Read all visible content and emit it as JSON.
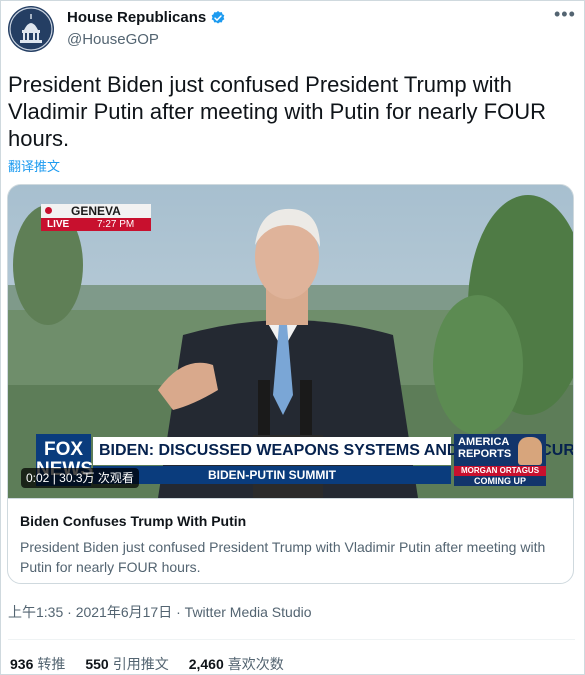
{
  "author": {
    "name": "House Republicans",
    "handle": "@HouseGOP",
    "verified": true,
    "avatar_icon": "capitol-dome-icon"
  },
  "tweet": {
    "text": "President Biden just confused President Trump with Vladimir Putin after meeting with Putin for nearly FOUR hours.",
    "translate_label": "翻译推文"
  },
  "video": {
    "location": "GENEVA",
    "live_label": "LIVE",
    "time": "7:27 PM",
    "network_logo": "FOX NEWS",
    "headline": "BIDEN: DISCUSSED WEAPONS SYSTEMS AND CYBERSECURITY",
    "subheadline": "BIDEN-PUTIN SUMMIT",
    "promo": {
      "show": "AMERICA REPORTS",
      "guest": "MORGAN ORTAGUS",
      "tag": "COMING UP"
    },
    "timestamp": "0:02",
    "views": "30.3万 次观看"
  },
  "card": {
    "title": "Biden Confuses Trump With Putin",
    "description": "President Biden just confused President Trump with Vladimir Putin after meeting with Putin for nearly FOUR hours."
  },
  "meta": {
    "time": "上午1:35",
    "date": "2021年6月17日",
    "source": "Twitter Media Studio"
  },
  "stats": {
    "retweets": {
      "count": "936",
      "label": "转推"
    },
    "quotes": {
      "count": "550",
      "label": "引用推文"
    },
    "likes": {
      "count": "2,460",
      "label": "喜欢次数"
    }
  },
  "colors": {
    "link": "#1d9bf0",
    "verified": "#1d9bf0",
    "fox_blue": "#0a3c7d",
    "fox_red": "#c8102e"
  }
}
